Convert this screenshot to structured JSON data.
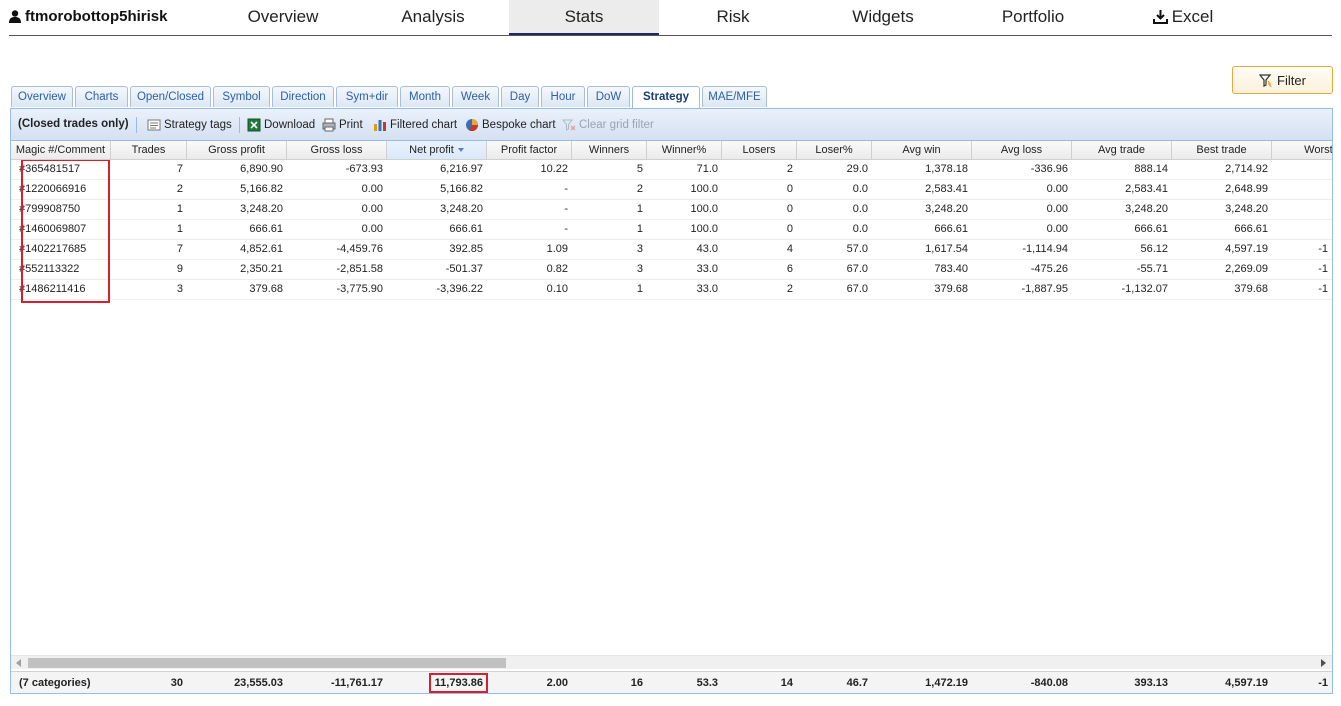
{
  "account": {
    "name": "ftmorobottop5hirisk",
    "icon": "user-icon"
  },
  "nav": [
    {
      "label": "Overview",
      "active": false
    },
    {
      "label": "Analysis",
      "active": false
    },
    {
      "label": "Stats",
      "active": true
    },
    {
      "label": "Risk",
      "active": false
    },
    {
      "label": "Widgets",
      "active": false
    },
    {
      "label": "Portfolio",
      "active": false
    },
    {
      "label": "Excel",
      "active": false,
      "icon": "download-icon"
    }
  ],
  "filter_button": {
    "label": "Filter",
    "icon": "filter-icon"
  },
  "subtabs": [
    {
      "label": "Overview"
    },
    {
      "label": "Charts"
    },
    {
      "label": "Open/Closed"
    },
    {
      "label": "Symbol"
    },
    {
      "label": "Direction"
    },
    {
      "label": "Sym+dir"
    },
    {
      "label": "Month"
    },
    {
      "label": "Week"
    },
    {
      "label": "Day"
    },
    {
      "label": "Hour"
    },
    {
      "label": "DoW"
    },
    {
      "label": "Strategy",
      "active": true
    },
    {
      "label": "MAE/MFE"
    }
  ],
  "toolbar": {
    "scope": "(Closed trades only)",
    "strategy_tags": "Strategy tags",
    "download": "Download",
    "print": "Print",
    "filtered_chart": "Filtered chart",
    "bespoke_chart": "Bespoke chart",
    "clear_grid_filter": "Clear grid filter"
  },
  "columns": [
    "Magic #/Comment",
    "Trades",
    "Gross profit",
    "Gross loss",
    "Net profit",
    "Profit factor",
    "Winners",
    "Winner%",
    "Losers",
    "Loser%",
    "Avg win",
    "Avg loss",
    "Avg trade",
    "Best trade",
    "Worst t"
  ],
  "sorted_column": "Net profit",
  "rows": [
    [
      "#365481517",
      "7",
      "6,890.90",
      "-673.93",
      "6,216.97",
      "10.22",
      "5",
      "71.0",
      "2",
      "29.0",
      "1,378.18",
      "-336.96",
      "888.14",
      "2,714.92",
      ""
    ],
    [
      "#1220066916",
      "2",
      "5,166.82",
      "0.00",
      "5,166.82",
      "-",
      "2",
      "100.0",
      "0",
      "0.0",
      "2,583.41",
      "0.00",
      "2,583.41",
      "2,648.99",
      ""
    ],
    [
      "#799908750",
      "1",
      "3,248.20",
      "0.00",
      "3,248.20",
      "-",
      "1",
      "100.0",
      "0",
      "0.0",
      "3,248.20",
      "0.00",
      "3,248.20",
      "3,248.20",
      ""
    ],
    [
      "#1460069807",
      "1",
      "666.61",
      "0.00",
      "666.61",
      "-",
      "1",
      "100.0",
      "0",
      "0.0",
      "666.61",
      "0.00",
      "666.61",
      "666.61",
      ""
    ],
    [
      "#1402217685",
      "7",
      "4,852.61",
      "-4,459.76",
      "392.85",
      "1.09",
      "3",
      "43.0",
      "4",
      "57.0",
      "1,617.54",
      "-1,114.94",
      "56.12",
      "4,597.19",
      "-1"
    ],
    [
      "#552113322",
      "9",
      "2,350.21",
      "-2,851.58",
      "-501.37",
      "0.82",
      "3",
      "33.0",
      "6",
      "67.0",
      "783.40",
      "-475.26",
      "-55.71",
      "2,269.09",
      "-1"
    ],
    [
      "#1486211416",
      "3",
      "379.68",
      "-3,775.90",
      "-3,396.22",
      "0.10",
      "1",
      "33.0",
      "2",
      "67.0",
      "379.68",
      "-1,887.95",
      "-1,132.07",
      "379.68",
      "-1"
    ]
  ],
  "totals": [
    "(7 categories)",
    "30",
    "23,555.03",
    "-11,761.17",
    "11,793.86",
    "2.00",
    "16",
    "53.3",
    "14",
    "46.7",
    "1,472.19",
    "-840.08",
    "393.13",
    "4,597.19",
    "-1"
  ],
  "colors": {
    "accent": "#1a2a6c",
    "grid_border": "#99bbe8",
    "highlight": "#d8202a",
    "tab_text": "#2f5f9f"
  }
}
